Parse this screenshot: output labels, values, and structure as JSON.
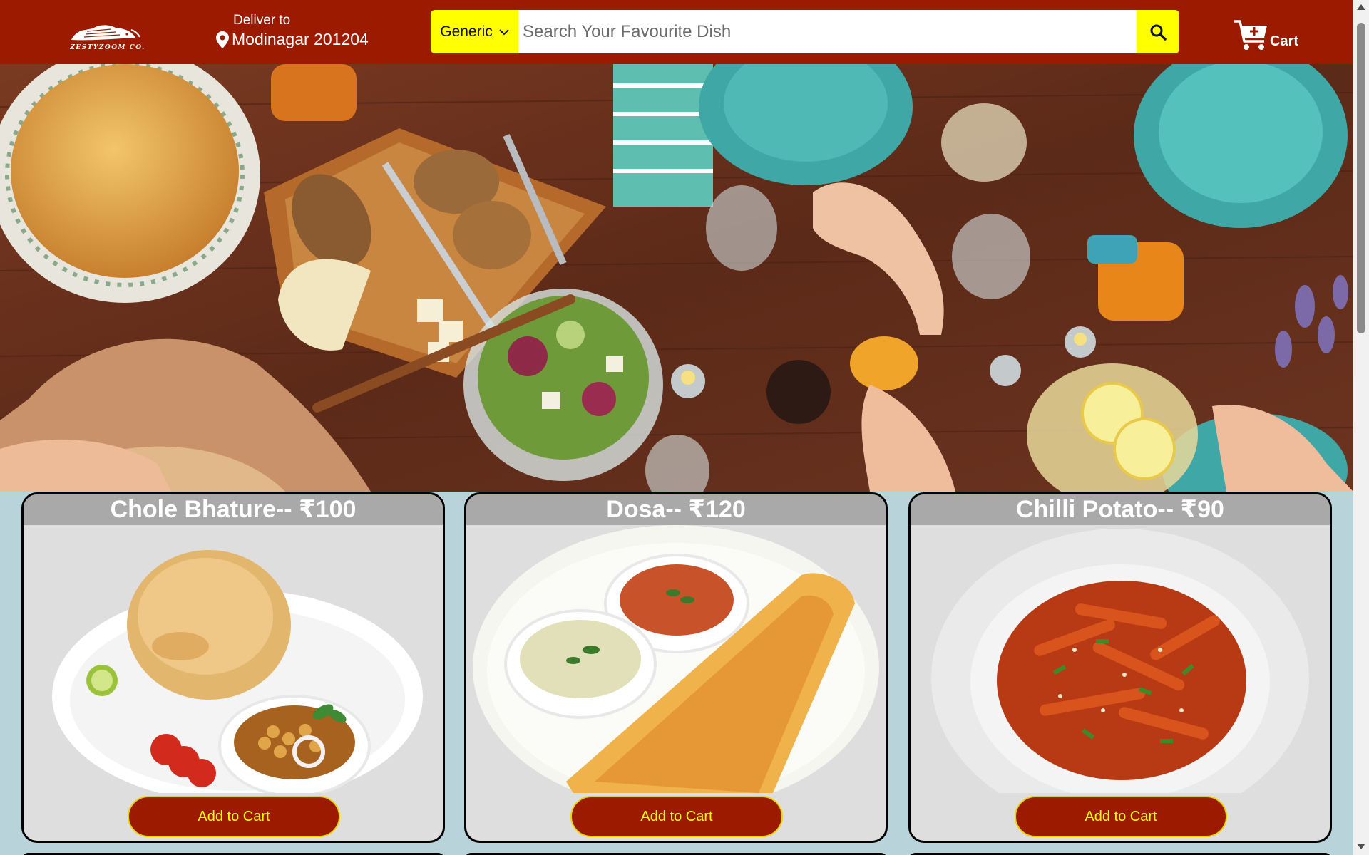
{
  "brand": {
    "name": "ZESTYZOOM CO."
  },
  "delivery": {
    "label": "Deliver to",
    "location": "Modinagar 201204"
  },
  "search": {
    "category": "Generic",
    "placeholder": "Search Your Favourite Dish",
    "value": ""
  },
  "cart": {
    "label": "Cart"
  },
  "hero": {
    "alt": "Dining table with food"
  },
  "products": [
    {
      "title": "Chole Bhature-- ₹100",
      "button": "Add to Cart"
    },
    {
      "title": "Dosa-- ₹120",
      "button": "Add to Cart"
    },
    {
      "title": "Chilli Potato-- ₹90",
      "button": "Add to Cart"
    }
  ],
  "colors": {
    "header": "#9c1b00",
    "accent": "#ffff00",
    "button": "#9c1b00",
    "buttonText": "#ffff00",
    "pageBackground": "#b8d4da"
  },
  "icons": {
    "location": "map-pin-icon",
    "search": "magnifier-icon",
    "cart": "cart-plus-icon",
    "dropdown": "chevron-down-icon"
  }
}
